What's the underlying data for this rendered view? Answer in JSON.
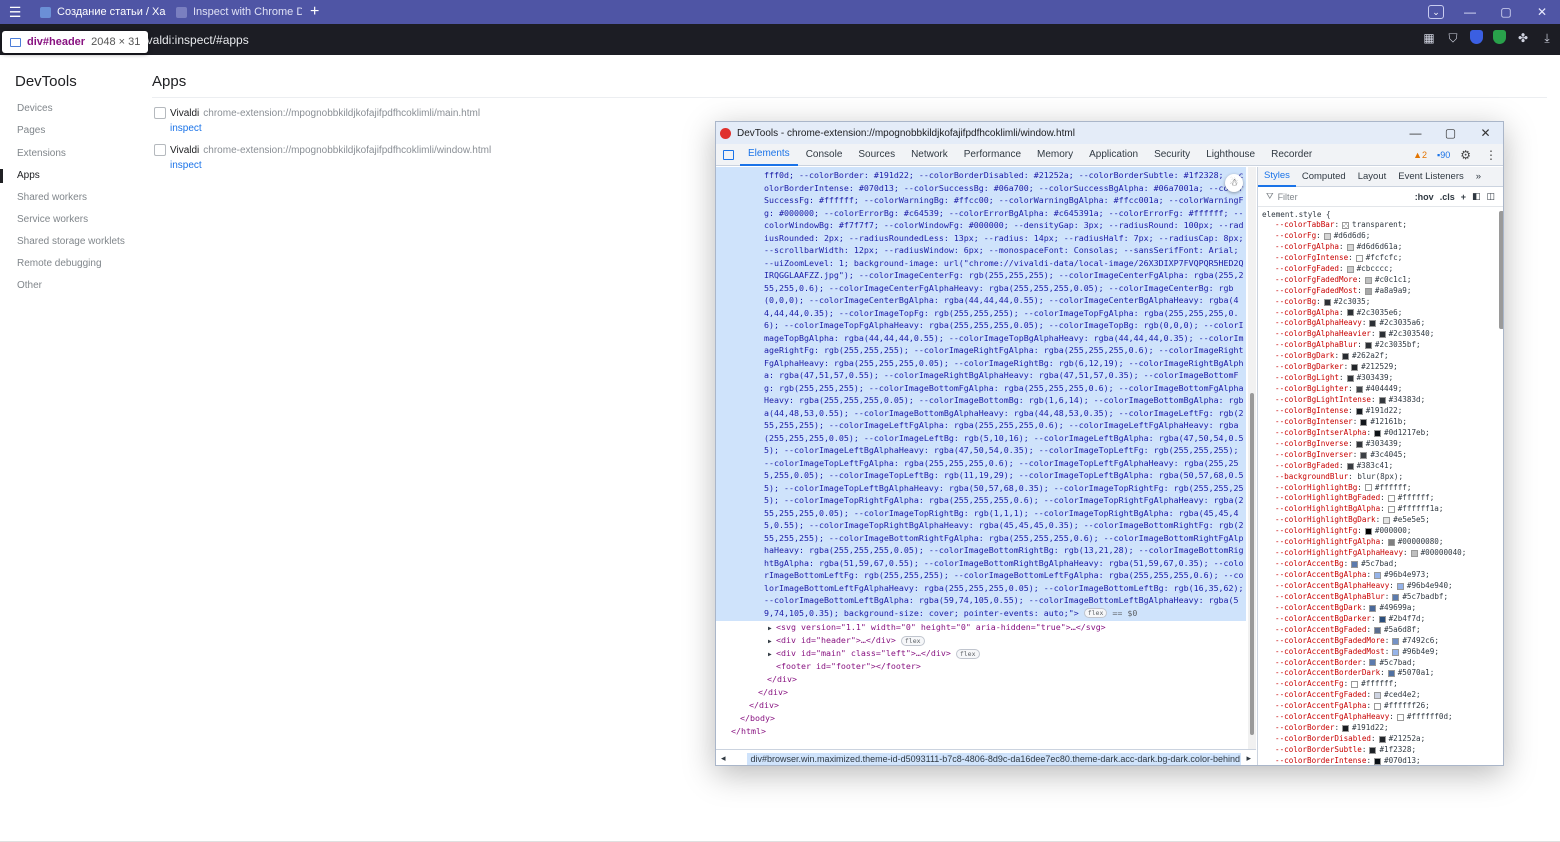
{
  "browser": {
    "tabs": [
      {
        "title": "Создание статьи / Хабр",
        "favicon_color": "#6b8fd6",
        "active": true
      },
      {
        "title": "Inspect with Chrome Devel",
        "favicon_color": "#7a7fc0",
        "active": false
      }
    ],
    "new_tab": "+",
    "url": "vivaldi:inspect/#apps",
    "tooltip": {
      "name": "div#header",
      "size": "2048 × 31"
    },
    "window_controls": [
      "—",
      "▢",
      "✕"
    ]
  },
  "inspect_page": {
    "title": "DevTools",
    "nav": [
      "Devices",
      "Pages",
      "Extensions",
      "Apps",
      "Shared workers",
      "Service workers",
      "Shared storage worklets",
      "Remote debugging",
      "Other"
    ],
    "active_nav": "Apps",
    "section_title": "Apps",
    "apps": [
      {
        "name": "Vivaldi",
        "url": "chrome-extension://mpognobbkildjkofajifpdfhcoklimli/main.html",
        "link": "inspect"
      },
      {
        "name": "Vivaldi",
        "url": "chrome-extension://mpognobbkildjkofajifpdfhcoklimli/window.html",
        "link": "inspect"
      }
    ]
  },
  "devtools": {
    "title": "DevTools - chrome-extension://mpognobbkildjkofajifpdfhcoklimli/window.html",
    "tabs": [
      "Elements",
      "Console",
      "Sources",
      "Network",
      "Performance",
      "Memory",
      "Application",
      "Security",
      "Lighthouse",
      "Recorder"
    ],
    "active_tab": "Elements",
    "warnings": "2",
    "infos": "90",
    "selected_style_text": "fff0d; --colorBorder: #191d22; --colorBorderDisabled: #21252a; --colorBorderSubtle: #1f2328; --colorBorderIntense: #070d13; --colorSuccessBg: #06a700; --colorSuccessBgAlpha: #06a7001a; --colorSuccessFg: #ffffff; --colorWarningBg: #ffcc00; --colorWarningBgAlpha: #ffcc001a; --colorWarningFg: #000000; --colorErrorBg: #c64539; --colorErrorBgAlpha: #c645391a; --colorErrorFg: #ffffff; --colorWindowBg: #f7f7f7; --colorWindowFg: #000000; --densityGap: 3px; --radiusRound: 100px; --radiusRounded: 2px; --radiusRoundedLess: 13px; --radius: 14px; --radiusHalf: 7px; --radiusCap: 8px; --scrollbarWidth: 12px; --radiusWindow: 6px; --monospaceFont: Consolas; --sansSerifFont: Arial; --uiZoomLevel: 1; background-image: url(\"chrome://vivaldi-data/local-image/26X3DIXP7FVQPQR5HED2QIRQGGLAAFZZ.jpg\"); --colorImageCenterFg: rgb(255,255,255); --colorImageCenterFgAlpha: rgba(255,255,255,0.6); --colorImageCenterFgAlphaHeavy: rgba(255,255,255,0.05); --colorImageCenterBg: rgb(0,0,0); --colorImageCenterBgAlpha: rgba(44,44,44,0.55); --colorImageCenterBgAlphaHeavy: rgba(44,44,44,0.35); --colorImageTopFg: rgb(255,255,255); --colorImageTopFgAlpha: rgba(255,255,255,0.6); --colorImageTopFgAlphaHeavy: rgba(255,255,255,0.05); --colorImageTopBg: rgb(0,0,0); --colorImageTopBgAlpha: rgba(44,44,44,0.55); --colorImageTopBgAlphaHeavy: rgba(44,44,44,0.35); --colorImageRightFg: rgb(255,255,255); --colorImageRightFgAlpha: rgba(255,255,255,0.6); --colorImageRightFgAlphaHeavy: rgba(255,255,255,0.05); --colorImageRightBg: rgb(6,12,19); --colorImageRightBgAlpha: rgba(47,51,57,0.55); --colorImageRightBgAlphaHeavy: rgba(47,51,57,0.35); --colorImageBottomFg: rgb(255,255,255); --colorImageBottomFgAlpha: rgba(255,255,255,0.6); --colorImageBottomFgAlphaHeavy: rgba(255,255,255,0.05); --colorImageBottomBg: rgb(1,6,14); --colorImageBottomBgAlpha: rgba(44,48,53,0.55); --colorImageBottomBgAlphaHeavy: rgba(44,48,53,0.35); --colorImageLeftFg: rgb(255,255,255); --colorImageLeftFgAlpha: rgba(255,255,255,0.6); --colorImageLeftFgAlphaHeavy: rgba(255,255,255,0.05); --colorImageLeftBg: rgb(5,10,16); --colorImageLeftBgAlpha: rgba(47,50,54,0.55); --colorImageLeftBgAlphaHeavy: rgba(47,50,54,0.35); --colorImageTopLeftFg: rgb(255,255,255); --colorImageTopLeftFgAlpha: rgba(255,255,255,0.6); --colorImageTopLeftFgAlphaHeavy: rgba(255,255,255,0.05); --colorImageTopLeftBg: rgb(11,19,29); --colorImageTopLeftBgAlpha: rgba(50,57,68,0.55); --colorImageTopLeftBgAlphaHeavy: rgba(50,57,68,0.35); --colorImageTopRightFg: rgb(255,255,255); --colorImageTopRightFgAlpha: rgba(255,255,255,0.6); --colorImageTopRightFgAlphaHeavy: rgba(255,255,255,0.05); --colorImageTopRightBg: rgb(1,1,1); --colorImageTopRightBgAlpha: rgba(45,45,45,0.55); --colorImageTopRightBgAlphaHeavy: rgba(45,45,45,0.35); --colorImageBottomRightFg: rgb(255,255,255); --colorImageBottomRightFgAlpha: rgba(255,255,255,0.6); --colorImageBottomRightFgAlphaHeavy: rgba(255,255,255,0.05); --colorImageBottomRightBg: rgb(13,21,28); --colorImageBottomRightBgAlpha: rgba(51,59,67,0.55); --colorImageBottomRightBgAlphaHeavy: rgba(51,59,67,0.35); --colorImageBottomLeftFg: rgb(255,255,255); --colorImageBottomLeftFgAlpha: rgba(255,255,255,0.6); --colorImageBottomLeftFgAlphaHeavy: rgba(255,255,255,0.05); --colorImageBottomLeftBg: rgb(16,35,62); --colorImageBottomLeftBgAlpha: rgba(59,74,105,0.55); --colorImageBottomLeftBgAlphaHeavy: rgba(59,74,105,0.35); background-size: cover; pointer-events: auto;",
    "selected_tail": "\">",
    "selected_eq": "== $0",
    "flex_badge": "flex",
    "dom_lines": [
      {
        "indent": 0,
        "tri": "▶",
        "html": "<svg version=\"1.1\" width=\"0\" height=\"0\" aria-hidden=\"true\">…</svg>",
        "badge": ""
      },
      {
        "indent": 0,
        "tri": "▶",
        "html": "<div id=\"header\">…</div>",
        "badge": "flex"
      },
      {
        "indent": 0,
        "tri": "▶",
        "html": "<div id=\"main\" class=\"left\">…</div>",
        "badge": "flex"
      },
      {
        "indent": 0,
        "tri": "",
        "html": "<footer id=\"footer\"></footer>",
        "badge": ""
      },
      {
        "indent": -1,
        "tri": "",
        "html": "</div>",
        "badge": ""
      },
      {
        "indent": -2,
        "tri": "",
        "html": "</div>",
        "badge": ""
      },
      {
        "indent": -3,
        "tri": "",
        "html": "</div>",
        "badge": ""
      },
      {
        "indent": -4,
        "tri": "",
        "html": "</body>",
        "badge": ""
      },
      {
        "indent": -5,
        "tri": "",
        "html": "</html>",
        "badge": ""
      }
    ],
    "breadcrumb": "div#browser.win.maximized.theme-id-d5093111-b7c8-4806-8d9c-da16dee7ec80.theme-dark.acc-dark.bg-dark.color-behind",
    "styles_tabs": [
      "Styles",
      "Computed",
      "Layout",
      "Event Listeners",
      "»"
    ],
    "active_styles_tab": "Styles",
    "filter_placeholder": "Filter",
    "filter_buttons": [
      ":hov",
      ".cls",
      "+"
    ],
    "rule_selector": "element.style {",
    "declarations": [
      {
        "name": "--colorTabBar",
        "value": "transparent",
        "color": "transparent"
      },
      {
        "name": "--colorFg",
        "value": "#d6d6d6",
        "color": "#d6d6d6"
      },
      {
        "name": "--colorFgAlpha",
        "value": "#d6d6d61a",
        "color": "#d6d6d6"
      },
      {
        "name": "--colorFgIntense",
        "value": "#fcfcfc",
        "color": "#fcfcfc"
      },
      {
        "name": "--colorFgFaded",
        "value": "#cbcccc",
        "color": "#cbcccc"
      },
      {
        "name": "--colorFgFadedMore",
        "value": "#c0c1c1",
        "color": "#c0c1c1"
      },
      {
        "name": "--colorFgFadedMost",
        "value": "#a8a9a9",
        "color": "#a8a9a9"
      },
      {
        "name": "--colorBg",
        "value": "#2c3035",
        "color": "#2c3035"
      },
      {
        "name": "--colorBgAlpha",
        "value": "#2c3035e6",
        "color": "#2c3035"
      },
      {
        "name": "--colorBgAlphaHeavy",
        "value": "#2c3035a6",
        "color": "#2c3035"
      },
      {
        "name": "--colorBgAlphaHeavier",
        "value": "#2c303540",
        "color": "#2c3035"
      },
      {
        "name": "--colorBgAlphaBlur",
        "value": "#2c3035bf",
        "color": "#2c3035"
      },
      {
        "name": "--colorBgDark",
        "value": "#262a2f",
        "color": "#262a2f"
      },
      {
        "name": "--colorBgDarker",
        "value": "#212529",
        "color": "#212529"
      },
      {
        "name": "--colorBgLight",
        "value": "#303439",
        "color": "#303439"
      },
      {
        "name": "--colorBgLighter",
        "value": "#404449",
        "color": "#404449"
      },
      {
        "name": "--colorBgLightIntense",
        "value": "#34383d",
        "color": "#34383d"
      },
      {
        "name": "--colorBgIntense",
        "value": "#191d22",
        "color": "#191d22"
      },
      {
        "name": "--colorBgIntenser",
        "value": "#12161b",
        "color": "#12161b"
      },
      {
        "name": "--colorBgIntserAlpha",
        "value": "#0d1217eb",
        "color": "#0d1217"
      },
      {
        "name": "--colorBgInverse",
        "value": "#303439",
        "color": "#303439"
      },
      {
        "name": "--colorBgInverser",
        "value": "#3c4045",
        "color": "#3c4045"
      },
      {
        "name": "--colorBgFaded",
        "value": "#383c41",
        "color": "#383c41"
      },
      {
        "name": "--backgroundBlur",
        "value": "blur(8px)",
        "color": ""
      },
      {
        "name": "--colorHighlightBg",
        "value": "#ffffff",
        "color": "#ffffff"
      },
      {
        "name": "--colorHighlightBgFaded",
        "value": "#ffffff",
        "color": "#ffffff"
      },
      {
        "name": "--colorHighlightBgAlpha",
        "value": "#ffffff1a",
        "color": "#ffffff"
      },
      {
        "name": "--colorHighlightBgDark",
        "value": "#e5e5e5",
        "color": "#e5e5e5"
      },
      {
        "name": "--colorHighlightFg",
        "value": "#000000",
        "color": "#000000"
      },
      {
        "name": "--colorHighlightFgAlpha",
        "value": "#00000080",
        "color": "#808080"
      },
      {
        "name": "--colorHighlightFgAlphaHeavy",
        "value": "#00000040",
        "color": "#bfbfbf"
      },
      {
        "name": "--colorAccentBg",
        "value": "#5c7bad",
        "color": "#5c7bad"
      },
      {
        "name": "--colorAccentBgAlpha",
        "value": "#96b4e973",
        "color": "#96b4e9"
      },
      {
        "name": "--colorAccentBgAlphaHeavy",
        "value": "#96b4e940",
        "color": "#96b4e9"
      },
      {
        "name": "--colorAccentBgAlphaBlur",
        "value": "#5c7badbf",
        "color": "#5c7bad"
      },
      {
        "name": "--colorAccentBgDark",
        "value": "#49699a",
        "color": "#49699a"
      },
      {
        "name": "--colorAccentBgDarker",
        "value": "#2b4f7d",
        "color": "#2b4f7d"
      },
      {
        "name": "--colorAccentBgFaded",
        "value": "#5a6d8f",
        "color": "#5a6d8f"
      },
      {
        "name": "--colorAccentBgFadedMore",
        "value": "#7492c6",
        "color": "#7492c6"
      },
      {
        "name": "--colorAccentBgFadedMost",
        "value": "#96b4e9",
        "color": "#96b4e9"
      },
      {
        "name": "--colorAccentBorder",
        "value": "#5c7bad",
        "color": "#5c7bad"
      },
      {
        "name": "--colorAccentBorderDark",
        "value": "#5070a1",
        "color": "#5070a1"
      },
      {
        "name": "--colorAccentFg",
        "value": "#ffffff",
        "color": "#ffffff"
      },
      {
        "name": "--colorAccentFgFaded",
        "value": "#ced4e2",
        "color": "#ced4e2"
      },
      {
        "name": "--colorAccentFgAlpha",
        "value": "#ffffff26",
        "color": "#ffffff"
      },
      {
        "name": "--colorAccentFgAlphaHeavy",
        "value": "#ffffff0d",
        "color": "#ffffff"
      },
      {
        "name": "--colorBorder",
        "value": "#191d22",
        "color": "#191d22"
      },
      {
        "name": "--colorBorderDisabled",
        "value": "#21252a",
        "color": "#21252a"
      },
      {
        "name": "--colorBorderSubtle",
        "value": "#1f2328",
        "color": "#1f2328"
      },
      {
        "name": "--colorBorderIntense",
        "value": "#070d13",
        "color": "#070d13"
      }
    ]
  }
}
